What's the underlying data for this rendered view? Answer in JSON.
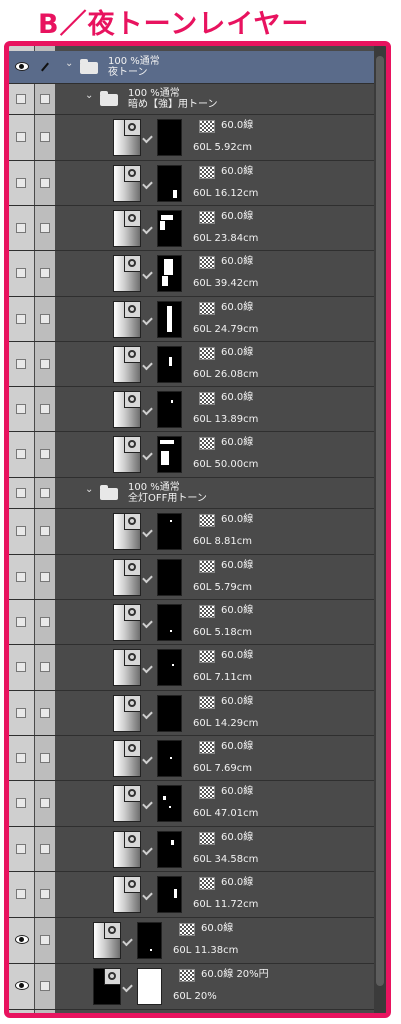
{
  "heading": "B／夜トーンレイヤー",
  "groups": [
    {
      "mode": "100 %通常",
      "name": "夜トーン"
    },
    {
      "mode": "100 %通常",
      "name": "暗め【強】用トーン"
    },
    {
      "mode": "100 %通常",
      "name": "全灯OFF用トーン"
    }
  ],
  "layers": [
    {
      "tone": "60.0線",
      "name": "60L 5.92cm"
    },
    {
      "tone": "60.0線",
      "name": "60L 16.12cm"
    },
    {
      "tone": "60.0線",
      "name": "60L 23.84cm"
    },
    {
      "tone": "60.0線",
      "name": "60L 39.42cm"
    },
    {
      "tone": "60.0線",
      "name": "60L 24.79cm"
    },
    {
      "tone": "60.0線",
      "name": "60L 26.08cm"
    },
    {
      "tone": "60.0線",
      "name": "60L 13.89cm"
    },
    {
      "tone": "60.0線",
      "name": "60L 50.00cm"
    },
    {
      "tone": "60.0線",
      "name": "60L 8.81cm"
    },
    {
      "tone": "60.0線",
      "name": "60L 5.79cm"
    },
    {
      "tone": "60.0線",
      "name": "60L 5.18cm"
    },
    {
      "tone": "60.0線",
      "name": "60L 7.11cm"
    },
    {
      "tone": "60.0線",
      "name": "60L 14.29cm"
    },
    {
      "tone": "60.0線",
      "name": "60L 7.69cm"
    },
    {
      "tone": "60.0線",
      "name": "60L 47.01cm"
    },
    {
      "tone": "60.0線",
      "name": "60L 34.58cm"
    },
    {
      "tone": "60.0線",
      "name": "60L 11.72cm"
    },
    {
      "tone": "60.0線",
      "name": "60L 11.38cm"
    },
    {
      "tone": "60.0線 20%円",
      "name": "60L 20%"
    }
  ],
  "colors": {
    "accent": "#e8135f",
    "panel": "#4a4a4a",
    "selected": "#5a6b8a"
  },
  "icons": {
    "visibility": "eye-icon",
    "lock": "checkbox",
    "edit": "pen-icon",
    "group": "folder-icon",
    "tone": "checker-tone-icon"
  }
}
